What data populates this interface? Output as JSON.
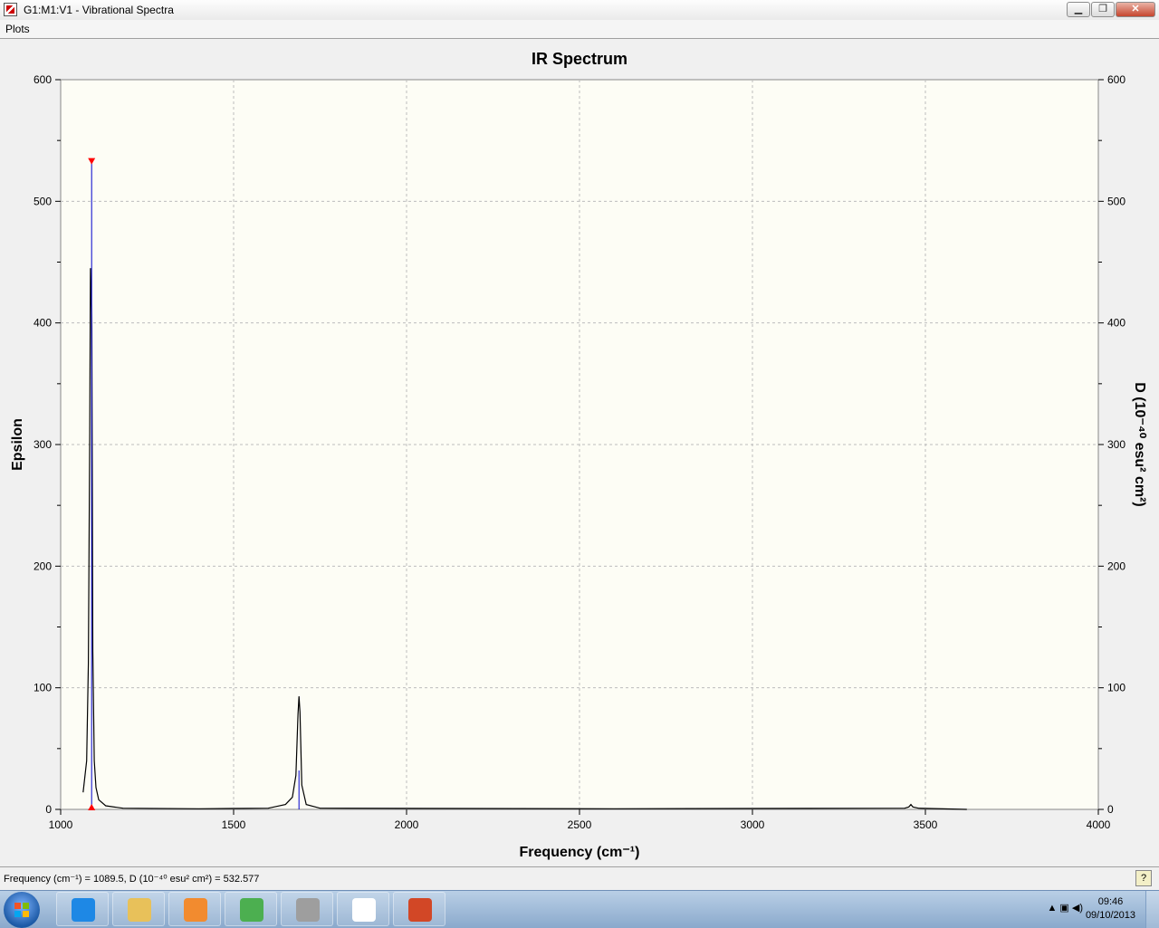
{
  "window": {
    "title": "G1:M1:V1 - Vibrational Spectra",
    "buttons": {
      "minimize": "▁",
      "restore": "❐",
      "close": "✕"
    }
  },
  "menu": {
    "items": [
      "Plots"
    ]
  },
  "chart_data": {
    "type": "line",
    "title": "IR Spectrum",
    "xlabel": "Frequency (cm⁻¹)",
    "ylabel": "Epsilon",
    "y2label": "D (10⁻⁴⁰ esu² cm²)",
    "xlim": [
      1000,
      4000
    ],
    "ylim": [
      0,
      600
    ],
    "xticks": [
      1000,
      1500,
      2000,
      2500,
      3000,
      3500,
      4000
    ],
    "yticks": [
      0,
      100,
      200,
      300,
      400,
      500,
      600
    ],
    "grid": true,
    "background": "#fdfdf5",
    "line_color": "#000000",
    "stick_color": "#0000cc",
    "marker_color": "#ff0000",
    "series": [
      {
        "values": [
          [
            1065,
            14
          ],
          [
            1075,
            40
          ],
          [
            1080,
            120
          ],
          [
            1084,
            310
          ],
          [
            1086,
            445
          ],
          [
            1088,
            430
          ],
          [
            1090,
            395
          ],
          [
            1093,
            130
          ],
          [
            1097,
            40
          ],
          [
            1102,
            18
          ],
          [
            1110,
            8
          ],
          [
            1130,
            3
          ],
          [
            1180,
            1
          ],
          [
            1400,
            0.5
          ],
          [
            1600,
            1
          ],
          [
            1650,
            4
          ],
          [
            1670,
            10
          ],
          [
            1680,
            28
          ],
          [
            1686,
            78
          ],
          [
            1689,
            93
          ],
          [
            1692,
            80
          ],
          [
            1697,
            20
          ],
          [
            1710,
            4
          ],
          [
            1750,
            1
          ],
          [
            2600,
            0.5
          ],
          [
            3440,
            1
          ],
          [
            3452,
            2
          ],
          [
            3458,
            4
          ],
          [
            3464,
            2
          ],
          [
            3480,
            1
          ],
          [
            3620,
            0
          ]
        ]
      }
    ],
    "sticks": [
      {
        "x": 1089.5,
        "y": 532.577
      },
      {
        "x": 1689,
        "y": 32
      }
    ]
  },
  "status": {
    "readout": "Frequency (cm⁻¹) = 1089.5, D (10⁻⁴⁰ esu² cm²) = 532.577",
    "help_icon": "?"
  },
  "taskbar": {
    "apps": [
      {
        "name": "ie-icon",
        "color": "#1e88e5"
      },
      {
        "name": "folder-icon",
        "color": "#e8c15a"
      },
      {
        "name": "media-player-icon",
        "color": "#f28b2f"
      },
      {
        "name": "chrome-icon",
        "color": "#4caf50"
      },
      {
        "name": "molecule-tool-icon",
        "color": "#9e9e9e"
      },
      {
        "name": "gaussview-icon",
        "color": "#ffffff"
      },
      {
        "name": "powerpoint-icon",
        "color": "#d24726"
      }
    ],
    "time": "09:46",
    "date": "09/10/2013"
  }
}
